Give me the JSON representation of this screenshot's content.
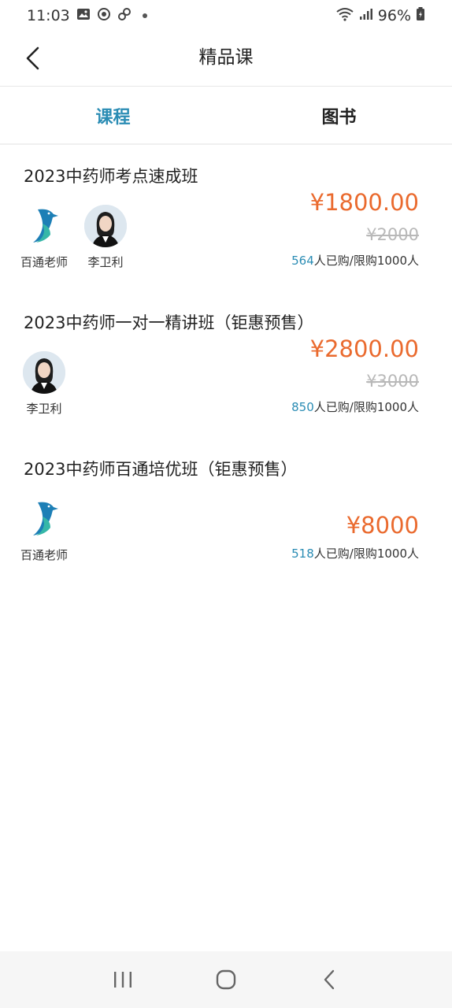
{
  "status_bar": {
    "time": "11:03",
    "battery": "96%"
  },
  "header": {
    "title": "精品课"
  },
  "tabs": [
    {
      "label": "课程",
      "active": true
    },
    {
      "label": "图书",
      "active": false
    }
  ],
  "courses": [
    {
      "title": "2023中药师考点速成班",
      "teachers": [
        {
          "name": "百通老师",
          "type": "logo"
        },
        {
          "name": "李卫利",
          "type": "photo"
        }
      ],
      "price": "¥1800.00",
      "original_price": "¥2000",
      "sold": "564",
      "sales_suffix": "人已购/限购1000人"
    },
    {
      "title": "2023中药师一对一精讲班（钜惠预售）",
      "teachers": [
        {
          "name": "李卫利",
          "type": "photo"
        }
      ],
      "price": "¥2800.00",
      "original_price": "¥3000",
      "sold": "850",
      "sales_suffix": "人已购/限购1000人"
    },
    {
      "title": "2023中药师百通培优班（钜惠预售）",
      "teachers": [
        {
          "name": "百通老师",
          "type": "logo"
        }
      ],
      "price": "¥8000",
      "original_price": "",
      "sold": "518",
      "sales_suffix": "人已购/限购1000人"
    }
  ],
  "colors": {
    "accent": "#2a8cb4",
    "price": "#ea6a2e",
    "strike": "#b8b8b8"
  }
}
